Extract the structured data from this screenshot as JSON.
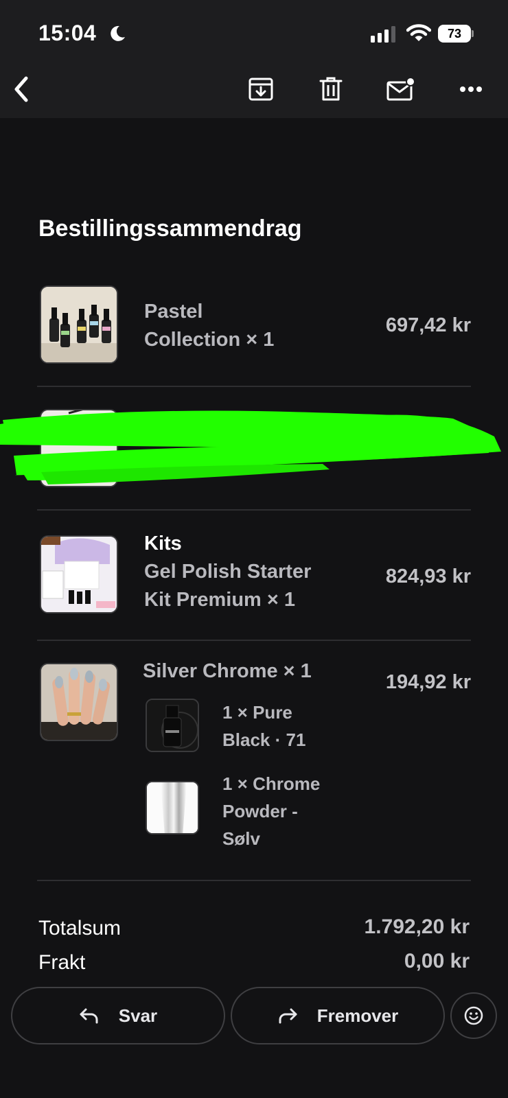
{
  "status": {
    "time": "15:04",
    "battery": "73"
  },
  "toolbar": {
    "back_icon": "chevron-left-icon",
    "archive_icon": "archive-icon",
    "delete_icon": "trash-icon",
    "unread_icon": "mail-unread-icon",
    "more_icon": "more-icon"
  },
  "heading": "Bestillingssammendrag",
  "items": [
    {
      "line1": "Pastel",
      "line2": "Collection × 1",
      "price": "697,42 kr"
    },
    {
      "redacted": true
    },
    {
      "line1": "Kits",
      "line2": "Gel Polish Starter",
      "line3": "Kit Premium × 1",
      "price": "824,93 kr"
    },
    {
      "line1": "Silver Chrome × 1",
      "price": "194,92 kr",
      "subitems": [
        {
          "line1": "1 × Pure",
          "line2": "Black · 71"
        },
        {
          "line1": "1 × Chrome",
          "line2": "Powder -",
          "line3": "Sølv"
        }
      ]
    }
  ],
  "summary": {
    "total_label": "Totalsum",
    "total_value": "1.792,20 kr",
    "shipping_label": "Frakt",
    "shipping_value": "0,00 kr"
  },
  "actions": {
    "reply": "Svar",
    "forward": "Fremover",
    "emoji_icon": "smiley-icon"
  },
  "colors": {
    "background": "#121214",
    "header": "#1d1d1f",
    "redaction": "#22ff00"
  }
}
